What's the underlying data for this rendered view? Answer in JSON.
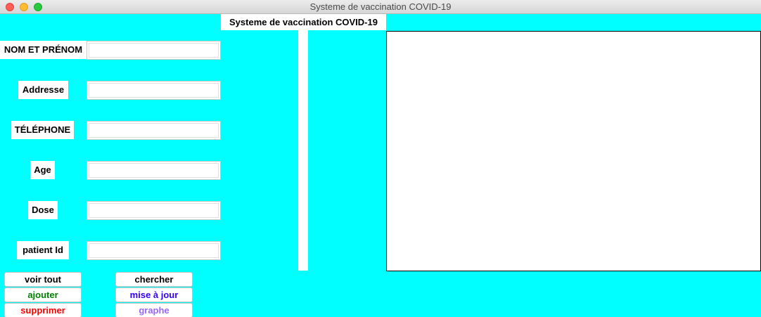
{
  "window": {
    "title": "Systeme de vaccination COVID-19"
  },
  "header": {
    "label": "Systeme de vaccination COVID-19"
  },
  "fields": [
    {
      "label": "NOM ET PRÉNOM",
      "value": ""
    },
    {
      "label": "Addresse",
      "value": ""
    },
    {
      "label": "TÉLÉPHONE",
      "value": ""
    },
    {
      "label": "Age",
      "value": ""
    },
    {
      "label": "Dose",
      "value": ""
    },
    {
      "label": "patient Id",
      "value": ""
    }
  ],
  "buttons": {
    "voir_tout": {
      "label": "voir tout",
      "color": "#000000"
    },
    "ajouter": {
      "label": "ajouter",
      "color": "#008000"
    },
    "supprimer": {
      "label": "supprimer",
      "color": "#ff0000"
    },
    "chercher": {
      "label": "chercher",
      "color": "#000000"
    },
    "mise_a_jour": {
      "label": "mise à jour",
      "color": "#3300ff"
    },
    "graphe": {
      "label": "graphe",
      "color": "#9966ff"
    }
  },
  "colors": {
    "background": "#00ffff"
  }
}
